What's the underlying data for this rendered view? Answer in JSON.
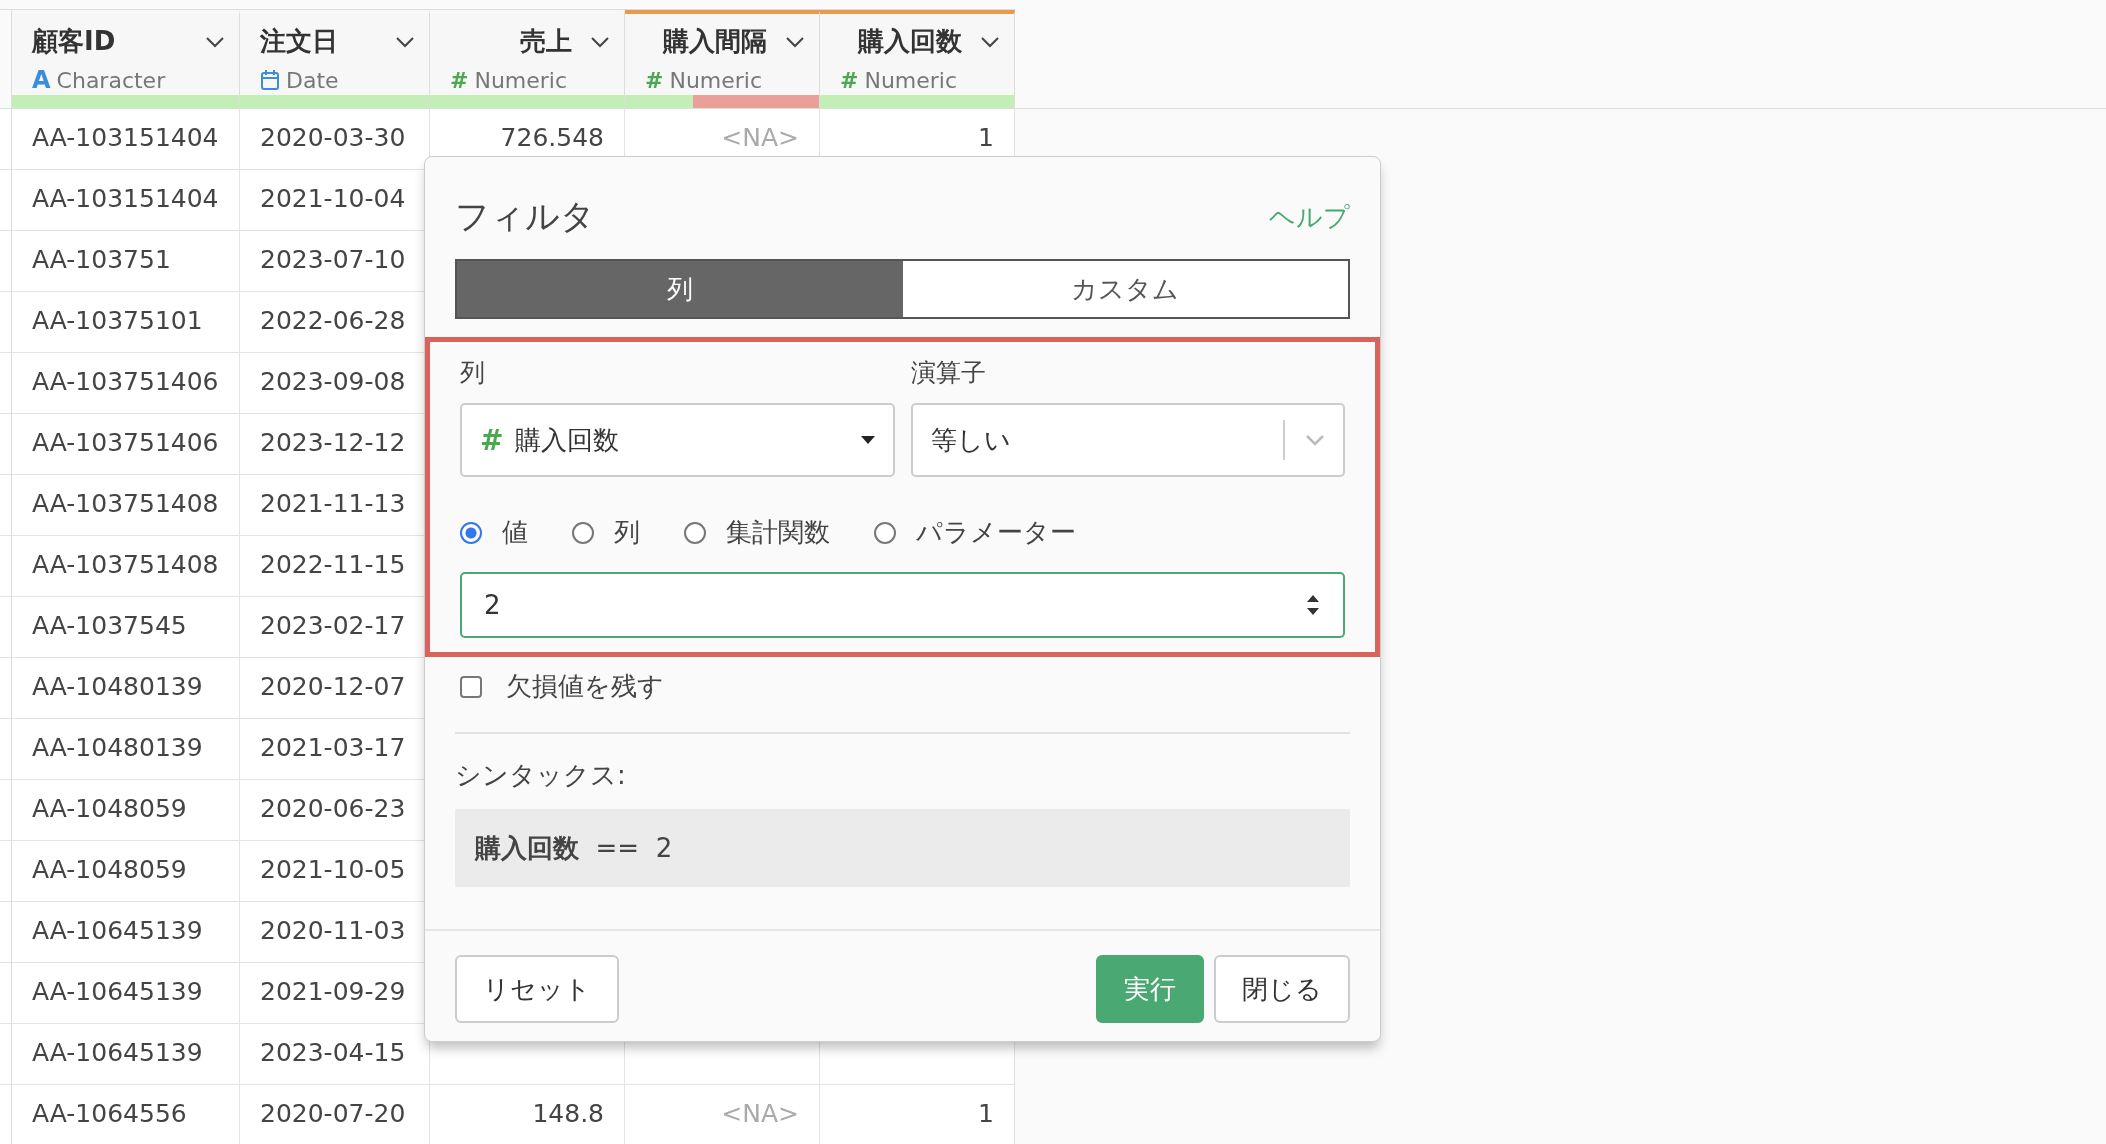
{
  "table": {
    "columns": [
      {
        "name": "顧客ID",
        "type": "Character",
        "kind": "character",
        "icon": "A",
        "highlighted": false,
        "level": 1
      },
      {
        "name": "注文日",
        "type": "Date",
        "kind": "date",
        "highlighted": false,
        "level": 1
      },
      {
        "name": "売上",
        "type": "Numeric",
        "kind": "numeric",
        "icon": "#",
        "highlighted": false,
        "level": 1
      },
      {
        "name": "購入間隔",
        "type": "Numeric",
        "kind": "numeric",
        "icon": "#",
        "highlighted": true,
        "level": 0.35
      },
      {
        "name": "購入回数",
        "type": "Numeric",
        "kind": "numeric",
        "icon": "#",
        "highlighted": true,
        "level": 1
      }
    ],
    "rows": [
      {
        "cells": [
          {
            "text": "AA-103151404",
            "missing": false
          },
          {
            "text": "2020-03-30",
            "missing": false
          },
          {
            "text": "726.548",
            "missing": false
          },
          {
            "text": "<NA>",
            "missing": true
          },
          {
            "text": "1",
            "missing": false
          }
        ]
      },
      {
        "cells": [
          {
            "text": "AA-103151404",
            "missing": false
          },
          {
            "text": "2021-10-04",
            "missing": false
          }
        ]
      },
      {
        "cells": [
          {
            "text": "AA-103751",
            "missing": false
          },
          {
            "text": "2023-07-10",
            "missing": false
          }
        ]
      },
      {
        "cells": [
          {
            "text": "AA-10375101",
            "missing": false
          },
          {
            "text": "2022-06-28",
            "missing": false
          }
        ]
      },
      {
        "cells": [
          {
            "text": "AA-103751406",
            "missing": false
          },
          {
            "text": "2023-09-08",
            "missing": false
          }
        ]
      },
      {
        "cells": [
          {
            "text": "AA-103751406",
            "missing": false
          },
          {
            "text": "2023-12-12",
            "missing": false
          }
        ]
      },
      {
        "cells": [
          {
            "text": "AA-103751408",
            "missing": false
          },
          {
            "text": "2021-11-13",
            "missing": false
          }
        ]
      },
      {
        "cells": [
          {
            "text": "AA-103751408",
            "missing": false
          },
          {
            "text": "2022-11-15",
            "missing": false
          }
        ]
      },
      {
        "cells": [
          {
            "text": "AA-1037545",
            "missing": false
          },
          {
            "text": "2023-02-17",
            "missing": false
          }
        ]
      },
      {
        "cells": [
          {
            "text": "AA-10480139",
            "missing": false
          },
          {
            "text": "2020-12-07",
            "missing": false
          }
        ]
      },
      {
        "cells": [
          {
            "text": "AA-10480139",
            "missing": false
          },
          {
            "text": "2021-03-17",
            "missing": false
          }
        ]
      },
      {
        "cells": [
          {
            "text": "AA-1048059",
            "missing": false
          },
          {
            "text": "2020-06-23",
            "missing": false
          }
        ]
      },
      {
        "cells": [
          {
            "text": "AA-1048059",
            "missing": false
          },
          {
            "text": "2021-10-05",
            "missing": false
          }
        ]
      },
      {
        "cells": [
          {
            "text": "AA-10645139",
            "missing": false
          },
          {
            "text": "2020-11-03",
            "missing": false
          }
        ]
      },
      {
        "cells": [
          {
            "text": "AA-10645139",
            "missing": false
          },
          {
            "text": "2021-09-29",
            "missing": false
          }
        ]
      },
      {
        "cells": [
          {
            "text": "AA-10645139",
            "missing": false
          },
          {
            "text": "2023-04-15",
            "missing": false
          }
        ]
      },
      {
        "cells": [
          {
            "text": "AA-1064556",
            "missing": false
          },
          {
            "text": "2020-07-20",
            "missing": false
          },
          {
            "text": "148.8",
            "missing": false
          },
          {
            "text": "<NA>",
            "missing": true
          },
          {
            "text": "1",
            "missing": false
          }
        ]
      }
    ]
  },
  "filter_dialog": {
    "title": "フィルタ",
    "help_link": "ヘルプ",
    "tabs": [
      {
        "label": "列",
        "selected": true
      },
      {
        "label": "カスタム",
        "selected": false
      }
    ],
    "condition": {
      "highlighted": true,
      "column_label": "列",
      "column_select": {
        "icon": "#",
        "value": "購入回数"
      },
      "operator_label": "演算子",
      "operator_select": {
        "value": "等しい"
      },
      "value_types": [
        {
          "label": "値",
          "selected": true
        },
        {
          "label": "列",
          "selected": false
        },
        {
          "label": "集計関数",
          "selected": false
        },
        {
          "label": "パラメーター",
          "selected": false
        }
      ],
      "value_input": {
        "value": "2"
      }
    },
    "keep_missing": {
      "label": "欠損値を残す",
      "checked": false
    },
    "syntax_label": "シンタックス:",
    "syntax": "**購入回数**  ==  2",
    "buttons": {
      "reset": "リセット",
      "run": "実行",
      "close": "閉じる"
    }
  }
}
